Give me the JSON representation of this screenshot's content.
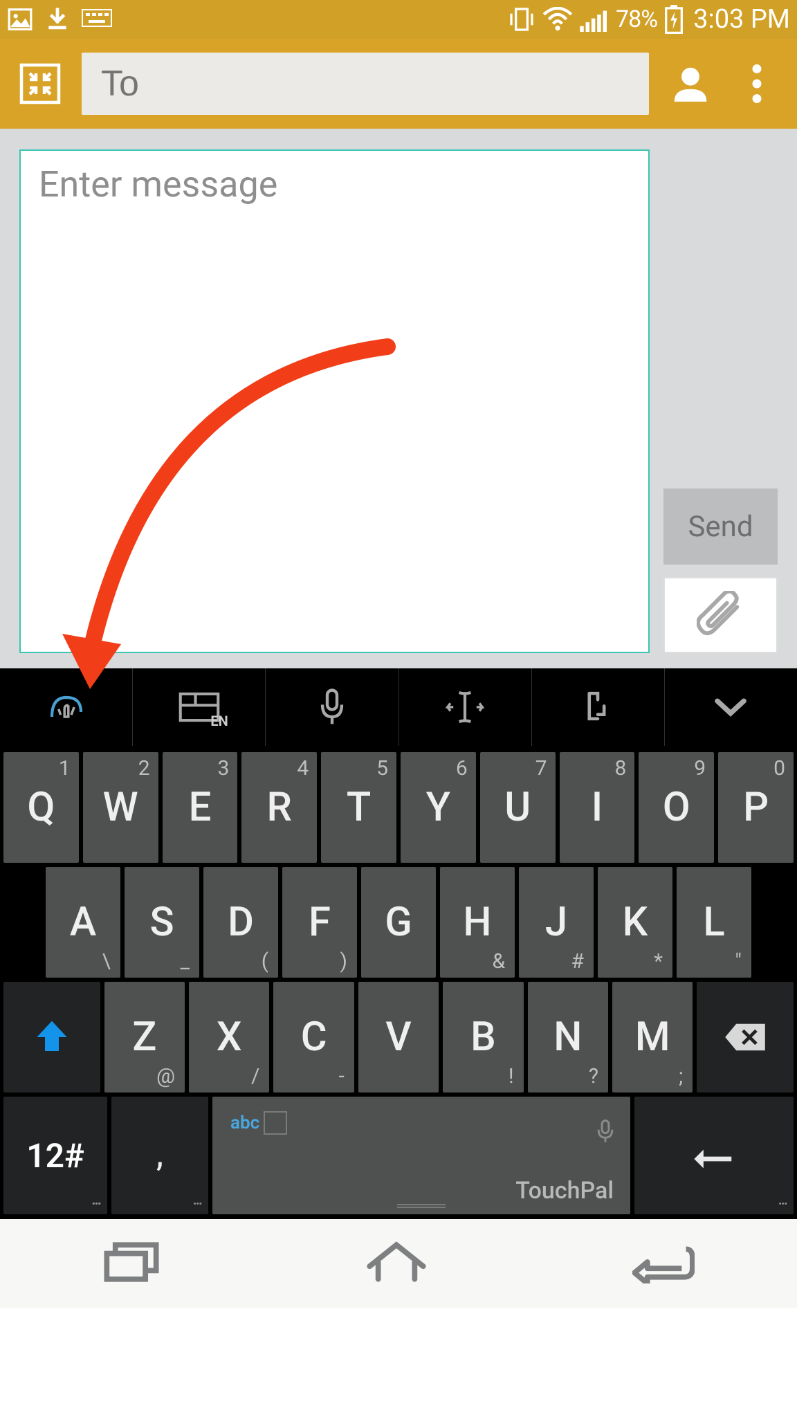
{
  "status": {
    "battery_pct": "78%",
    "time": "3:03 PM"
  },
  "header": {
    "to_placeholder": "To"
  },
  "compose": {
    "message_placeholder": "Enter message",
    "send_label": "Send"
  },
  "keyboard": {
    "toolbar_lang": "EN",
    "row1": [
      {
        "main": "Q",
        "num": "1"
      },
      {
        "main": "W",
        "num": "2"
      },
      {
        "main": "E",
        "num": "3"
      },
      {
        "main": "R",
        "num": "4"
      },
      {
        "main": "T",
        "num": "5"
      },
      {
        "main": "Y",
        "num": "6"
      },
      {
        "main": "U",
        "num": "7"
      },
      {
        "main": "I",
        "num": "8"
      },
      {
        "main": "O",
        "num": "9"
      },
      {
        "main": "P",
        "num": "0"
      }
    ],
    "row2": [
      {
        "main": "A",
        "sym": "\\"
      },
      {
        "main": "S",
        "sym": "_"
      },
      {
        "main": "D",
        "sym": "("
      },
      {
        "main": "F",
        "sym": ")"
      },
      {
        "main": "G",
        "sym": ""
      },
      {
        "main": "H",
        "sym": "&"
      },
      {
        "main": "J",
        "sym": "#"
      },
      {
        "main": "K",
        "sym": "*"
      },
      {
        "main": "L",
        "sym": "\""
      }
    ],
    "row3": [
      {
        "main": "Z",
        "sym": "@"
      },
      {
        "main": "X",
        "sym": "/"
      },
      {
        "main": "C",
        "sym": "-"
      },
      {
        "main": "V",
        "sym": ""
      },
      {
        "main": "B",
        "sym": "!"
      },
      {
        "main": "N",
        "sym": "?"
      },
      {
        "main": "M",
        "sym": ";"
      }
    ],
    "numeric_label": "12#",
    "comma_label": ",",
    "space_abc": "abc",
    "space_brand": "TouchPal"
  }
}
